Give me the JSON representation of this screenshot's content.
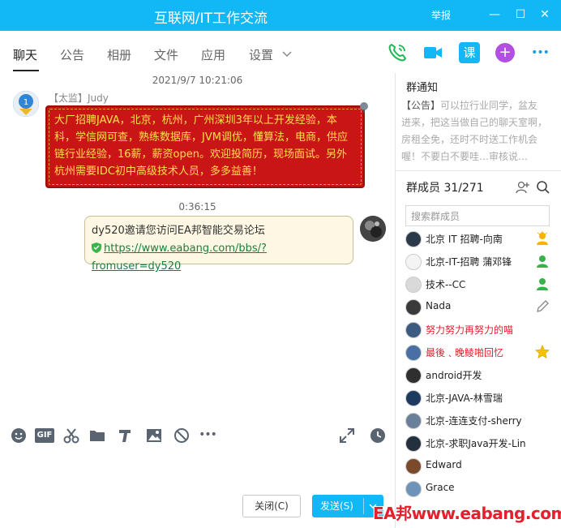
{
  "window": {
    "title": "互联网/IT工作交流",
    "report_label": "举报",
    "minimize_glyph": "—",
    "maximize_glyph": "☐",
    "close_glyph": "✕"
  },
  "tabs": [
    {
      "label": "聊天"
    },
    {
      "label": "公告"
    },
    {
      "label": "相册"
    },
    {
      "label": "文件"
    },
    {
      "label": "应用"
    },
    {
      "label": "设置"
    }
  ],
  "actions": [
    {
      "icon": "phone-icon"
    },
    {
      "icon": "video-icon"
    },
    {
      "icon": "lesson-icon",
      "label": "课"
    },
    {
      "icon": "add-app-icon",
      "label": "+"
    },
    {
      "icon": "more-icon",
      "label": "•••"
    }
  ],
  "chat": {
    "timestamp1": "2021/9/7 10:21:06",
    "message1": {
      "sender": "【太监】Judy",
      "text": "大厂招聘JAVA，北京，杭州，广州深圳3年以上开发经验，本科，学信网可查，熟练数据库，JVM调优，懂算法，电商，供应链行业经验，16薪，薪资open。欢迎投简历，现场面试。另外杭州需要IDC初中高级技术人员，多多益善！"
    },
    "timestamp2": "0:36:15",
    "message2": {
      "text": "dy520邀请您访问EA邦智能交易论坛",
      "link": "https://www.eabang.com/bbs/?fromuser=dy520"
    }
  },
  "toolbar": {
    "tools": [
      "emoji-icon",
      "gif-icon",
      "scissors-icon",
      "folder-icon",
      "music-icon",
      "image-icon",
      "blocked-icon",
      "more-icon"
    ],
    "gif_label": "GIF"
  },
  "buttons": {
    "close_label": "关闭(C)",
    "send_label": "发送(S)"
  },
  "notice": {
    "heading": "群通知",
    "tag": "【公告】",
    "text": "可以拉行业同学，盆友进来，把这当做自己的聊天室啊，房租全免，还时不时送工作机会喔！不要白不要哇…审核说…"
  },
  "members": {
    "heading": "群成员 31/271",
    "search_placeholder": "搜索群成员",
    "list": [
      {
        "name": "北京 IT 招聘-向南",
        "badge": "owner-icon",
        "red": false
      },
      {
        "name": "北京-IT-招聘 蒲邓锋",
        "badge": "admin-icon",
        "red": false
      },
      {
        "name": "技术--CC",
        "badge": "admin-icon",
        "red": false
      },
      {
        "name": "Nada",
        "badge": "edit-icon",
        "red": false
      },
      {
        "name": "努力努力再努力的喵",
        "badge": "",
        "red": true
      },
      {
        "name": "最後﹑晚鲮啪回忆",
        "badge": "star-icon",
        "red": true
      },
      {
        "name": "android开发",
        "badge": "",
        "red": false
      },
      {
        "name": "北京-JAVA-林雪瑞",
        "badge": "",
        "red": false
      },
      {
        "name": "北京-连连支付-sherry",
        "badge": "",
        "red": false
      },
      {
        "name": "北京-求职Java开发-Lin",
        "badge": "",
        "red": false
      },
      {
        "name": "Edward",
        "badge": "",
        "red": false
      },
      {
        "name": "Grace",
        "badge": "",
        "red": false
      }
    ]
  },
  "watermark": "EA邦www.eabang.com",
  "colors": {
    "accent": "#12b7f5",
    "red_bubble": "#c91515",
    "red_text": "#ffe04a",
    "link_green": "#1b7e3c"
  }
}
